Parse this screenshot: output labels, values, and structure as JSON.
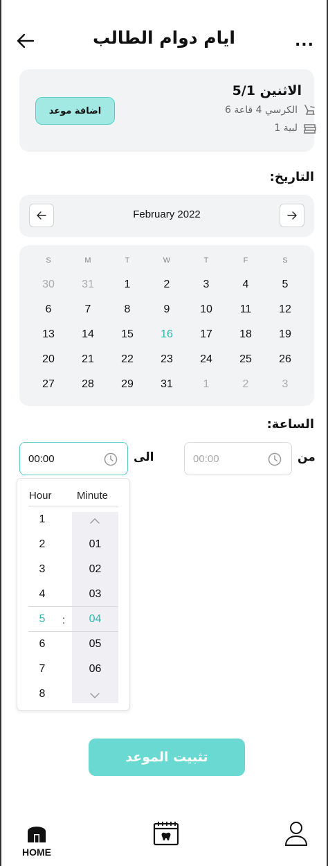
{
  "header": {
    "title": "ايام دوام الطالب",
    "back_icon": "arrow-left-icon",
    "more_label": "..."
  },
  "appointment": {
    "day": "الاثنين 5/1",
    "chair_text": "الكرسي 4 قاعة 6",
    "level_text": "لبية 1",
    "add_button": "اضافة موعد"
  },
  "date_section": {
    "label": "التاريخ:",
    "month": "February 2022",
    "weekdays": [
      "S",
      "M",
      "T",
      "W",
      "T",
      "F",
      "S"
    ],
    "weeks": [
      [
        {
          "d": "30",
          "m": true
        },
        {
          "d": "31",
          "m": true
        },
        {
          "d": "1"
        },
        {
          "d": "2"
        },
        {
          "d": "3"
        },
        {
          "d": "4"
        },
        {
          "d": "5"
        }
      ],
      [
        {
          "d": "6"
        },
        {
          "d": "7"
        },
        {
          "d": "8"
        },
        {
          "d": "9"
        },
        {
          "d": "10"
        },
        {
          "d": "11"
        },
        {
          "d": "12"
        }
      ],
      [
        {
          "d": "13"
        },
        {
          "d": "14"
        },
        {
          "d": "15"
        },
        {
          "d": "16",
          "t": true
        },
        {
          "d": "17"
        },
        {
          "d": "18"
        },
        {
          "d": "19"
        }
      ],
      [
        {
          "d": "20"
        },
        {
          "d": "21"
        },
        {
          "d": "22"
        },
        {
          "d": "23"
        },
        {
          "d": "24"
        },
        {
          "d": "25"
        },
        {
          "d": "26"
        }
      ],
      [
        {
          "d": "27"
        },
        {
          "d": "28"
        },
        {
          "d": "29"
        },
        {
          "d": "31"
        },
        {
          "d": "1",
          "m": true
        },
        {
          "d": "2",
          "m": true
        },
        {
          "d": "3",
          "m": true
        }
      ]
    ]
  },
  "time_section": {
    "label": "الساعة:",
    "from_label": "من",
    "to_label": "الى",
    "from_placeholder": "00:00",
    "to_value": "00:00"
  },
  "picker": {
    "hour_header": "Hour",
    "minute_header": "Minute",
    "hours": [
      "1",
      "2",
      "3",
      "4",
      "5",
      "6",
      "7",
      "8"
    ],
    "minutes": [
      "01",
      "02",
      "03",
      "04",
      "05",
      "06"
    ],
    "selected_hour": "5",
    "selected_minute": "04",
    "separator": ":"
  },
  "submit_label": "تثبيت الموعد",
  "bottom_nav": {
    "home_label": "HOME"
  },
  "colors": {
    "accent": "#2fb8ad",
    "button": "#6ad9d1",
    "card": "#f2f3f4"
  }
}
